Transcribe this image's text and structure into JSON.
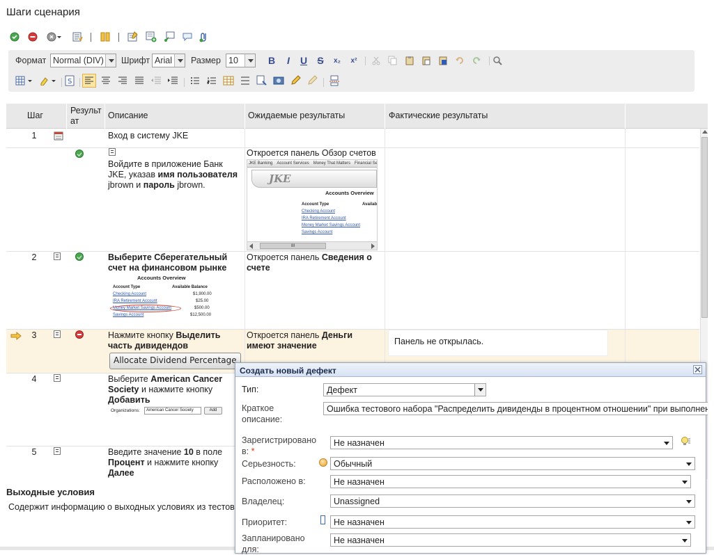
{
  "page": {
    "title": "Шаги сценария"
  },
  "top_toolbar": {
    "icons": [
      "pass-icon",
      "fail-icon",
      "status-menu-icon",
      "import-steps-icon",
      "split-columns-icon",
      "edit-step-icon",
      "add-step-icon",
      "link-icon",
      "comment-icon",
      "attachment-icon"
    ]
  },
  "editor_toolbar": {
    "format_label": "Формат",
    "format_value": "Normal (DIV)",
    "font_label": "Шрифт",
    "font_value": "Arial",
    "size_label": "Размер",
    "size_value": "10",
    "bold": "B",
    "italic": "I",
    "underline": "U",
    "strike": "S",
    "subscript": "x₂",
    "superscript": "x²"
  },
  "table": {
    "headers": {
      "step": "Шаг",
      "result": "Результат",
      "description": "Описание",
      "expected": "Ожидаемые результаты",
      "actual": "Фактические результаты"
    },
    "group": {
      "num": "1",
      "title": "Вход в систему JKE"
    },
    "rows": [
      {
        "num": "",
        "status": "ok",
        "desc_parts": [
          "Войдите в приложение Банк JKE, указав ",
          "имя пользователя",
          " jbrown и ",
          "пароль",
          " jbrown."
        ],
        "expected": "Откроется панель Обзор счетов",
        "actual": ""
      },
      {
        "num": "2",
        "status": "ok",
        "desc_bold": "Выберите Сберегательный счет на финансовом рынке",
        "expected_parts": [
          "Откроется панель ",
          "Сведения о счете"
        ],
        "actual": ""
      },
      {
        "num": "3",
        "status": "fail",
        "desc_parts": [
          "Нажмите кнопку ",
          "Выделить часть дивидендов"
        ],
        "button_label": "Allocate Dividend Percentage",
        "expected_parts": [
          "Откроется панель ",
          "Деньги имеют значение"
        ],
        "actual": "Панель не открылась."
      },
      {
        "num": "4",
        "status": "",
        "desc_parts": [
          "Выберите ",
          "American Cancer Society",
          " и нажмите кнопку ",
          "Добавить"
        ],
        "expected": "",
        "actual": ""
      },
      {
        "num": "5",
        "status": "",
        "desc_parts": [
          "Введите значение ",
          "10",
          " в поле ",
          "Процент",
          " и нажмите кнопку ",
          "Далее"
        ],
        "expected": "",
        "actual": ""
      }
    ],
    "mini_jke": {
      "tabs": [
        "JKE Banking",
        "Account Services",
        "Money That Matters",
        "Financial Se"
      ],
      "logo": "JKE",
      "heading": "Accounts Overview",
      "col_type": "Account Type",
      "col_balance": "Availab",
      "accounts": [
        "Checking Account",
        "IRA Retirement Account",
        "Money Market Savings Account",
        "Savings Account"
      ],
      "scroll_grip": "III"
    },
    "mini_overview": {
      "heading": "Accounts Overview",
      "col_type": "Account Type",
      "col_balance": "Available Balance",
      "accounts": [
        {
          "name": "Checking Account",
          "balance": "$1,900.00"
        },
        {
          "name": "IRA Retirement Account",
          "balance": "$25.00"
        },
        {
          "name": "Money Market Savings Account",
          "balance": "$500.00"
        },
        {
          "name": "Savings Account",
          "balance": "$12,500.00"
        }
      ]
    },
    "mini_org": {
      "label": "Organizations:",
      "value": "American Cancer Society",
      "add": "Add"
    }
  },
  "exit_conditions": {
    "title": "Выходные условия",
    "text": "Содержит информацию о выходных условиях из тестового"
  },
  "dialog": {
    "title": "Создать новый дефект",
    "fields": {
      "type_label": "Тип:",
      "type_value": "Дефект",
      "summary_label": "Краткое описание:",
      "summary_value": "Ошибка тестового набора \"Распределить дивиденды в процентном отношении\" при выполнении",
      "filed_label": "Зарегистрировано в:",
      "filed_required": "*",
      "filed_value": "Не назначен",
      "severity_label": "Серьезность:",
      "severity_value": "Обычный",
      "found_label": "Расположено в:",
      "found_value": "Не назначен",
      "owner_label": "Владелец:",
      "owner_value": "Unassigned",
      "priority_label": "Приоритет:",
      "priority_value": "Не назначен",
      "planned_label": "Запланировано для:",
      "planned_value": "Не назначен"
    }
  },
  "colors": {
    "accent": "#3a4e8c",
    "pass": "#4aa84e",
    "fail": "#d43c3c",
    "row_highlight": "#fdf3e1",
    "link": "#2c55b5"
  }
}
